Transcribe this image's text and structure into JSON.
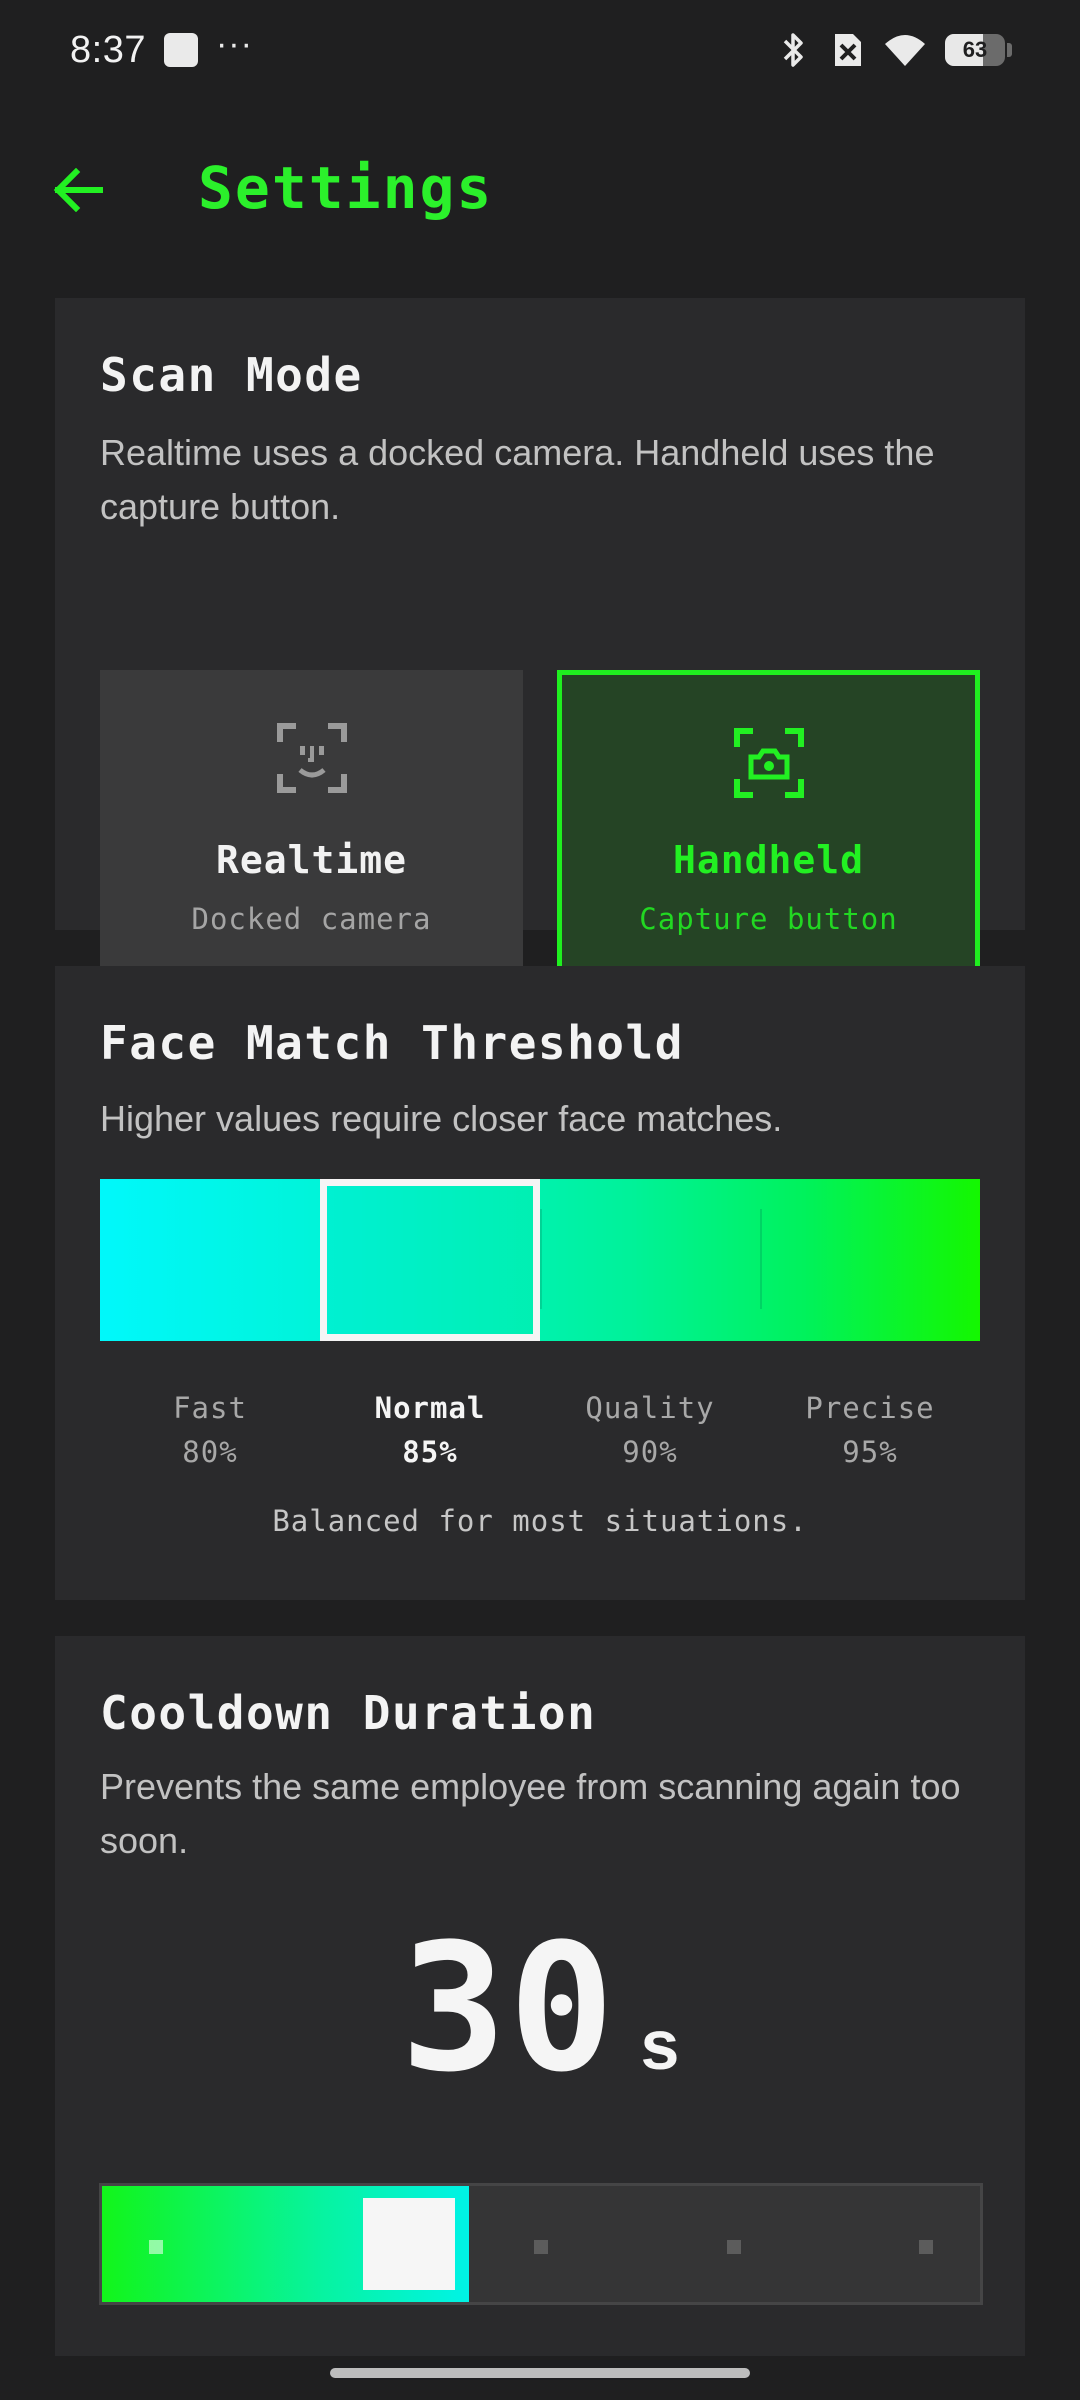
{
  "status_bar": {
    "time": "8:37",
    "dots": "···",
    "battery": "63",
    "battery_level_percent": 63
  },
  "header": {
    "title": "Settings"
  },
  "scan_mode": {
    "title": "Scan Mode",
    "description": "Realtime uses a docked camera. Handheld uses the capture button.",
    "options": [
      {
        "label": "Realtime",
        "sub": "Docked camera",
        "icon": "face-scan-icon",
        "selected": false
      },
      {
        "label": "Handheld",
        "sub": "Capture button",
        "icon": "camera-scan-icon",
        "selected": true
      }
    ]
  },
  "threshold": {
    "title": "Face Match Threshold",
    "description": "Higher values require closer face matches.",
    "levels": [
      {
        "name": "Fast",
        "value": "80%"
      },
      {
        "name": "Normal",
        "value": "85%"
      },
      {
        "name": "Quality",
        "value": "90%"
      },
      {
        "name": "Precise",
        "value": "95%"
      }
    ],
    "selected_index": 1,
    "caption": "Balanced for most situations."
  },
  "cooldown": {
    "title": "Cooldown Duration",
    "description": "Prevents the same employee from scanning again too soon.",
    "value": "30",
    "unit": "s",
    "selected_step": 1,
    "step_count": 5
  },
  "colors": {
    "accent": "#22f022",
    "background": "#1f1f20",
    "card": "#2a2a2c"
  }
}
